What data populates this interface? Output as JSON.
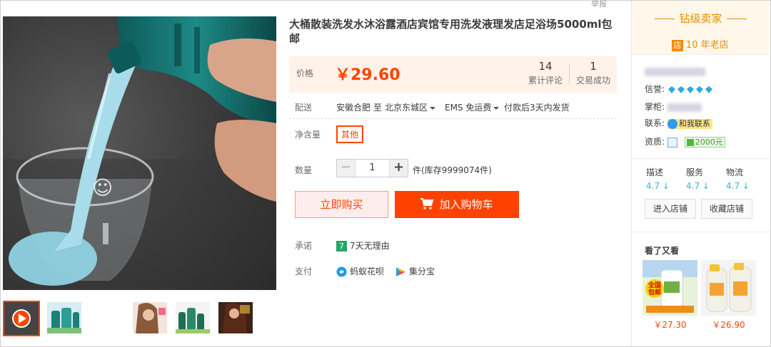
{
  "header": {
    "report_label": "举报"
  },
  "gallery": {
    "main_image": "video-frame-shampoo-pour",
    "thumbnails": [
      {
        "icon": "play-icon",
        "active": true
      },
      {
        "icon": "shampoo-product-thumb",
        "active": false
      },
      {
        "icon": "hair-model-thumb",
        "active": false
      },
      {
        "icon": "bottles-thumb",
        "active": false
      },
      {
        "icon": "hair-model-dark-thumb",
        "active": false
      }
    ]
  },
  "product": {
    "title": "大桶散装洗发水沐浴露酒店宾馆专用洗发液理发店足浴场5000ml包邮",
    "price_label": "价格",
    "price": "￥29.60",
    "reviews_count": "14",
    "reviews_label": "累计评论",
    "deals_count": "1",
    "deals_label": "交易成功"
  },
  "shipping": {
    "label": "配送",
    "from": "安徽合肥 至",
    "to": "北京东城区",
    "method": "EMS 免运费",
    "delivery": "付款后3天内发货"
  },
  "options": {
    "label": "净含量",
    "selected": "其他"
  },
  "quantity": {
    "label": "数量",
    "minus": "−",
    "value": "1",
    "plus": "+",
    "stock": "件(库存9999074件)"
  },
  "actions": {
    "buy_now": "立即购买",
    "add_to_cart": "加入购物车"
  },
  "promise": {
    "label": "承诺",
    "badge": "7",
    "text": "7天无理由"
  },
  "payment": {
    "label": "支付",
    "method1": "蚂蚁花呗",
    "method2": "集分宝"
  },
  "seller": {
    "level": "钻级卖家",
    "store_icon": "店",
    "years": "10 年老店",
    "credit_label": "信誉:",
    "owner_label": "掌柜:",
    "contact_label": "联系:",
    "contact_button": "和我联系",
    "qual_label": "资质:",
    "deposit": "2000元",
    "ratings": [
      {
        "name": "描述",
        "score": "4.7"
      },
      {
        "name": "服务",
        "score": "4.7"
      },
      {
        "name": "物流",
        "score": "4.7"
      }
    ],
    "enter_shop": "进入店铺",
    "fav_shop": "收藏店铺"
  },
  "also_viewed": {
    "title": "看了又看",
    "items": [
      {
        "price": "￥27.30",
        "badge_line1": "全国",
        "badge_line2": "包邮"
      },
      {
        "price": "￥26.90"
      }
    ]
  },
  "colors": {
    "accent": "#ff4400",
    "price_bg": "#fff2e8",
    "seller_gold": "#e88b00",
    "rating_blue": "#3db3d8"
  }
}
